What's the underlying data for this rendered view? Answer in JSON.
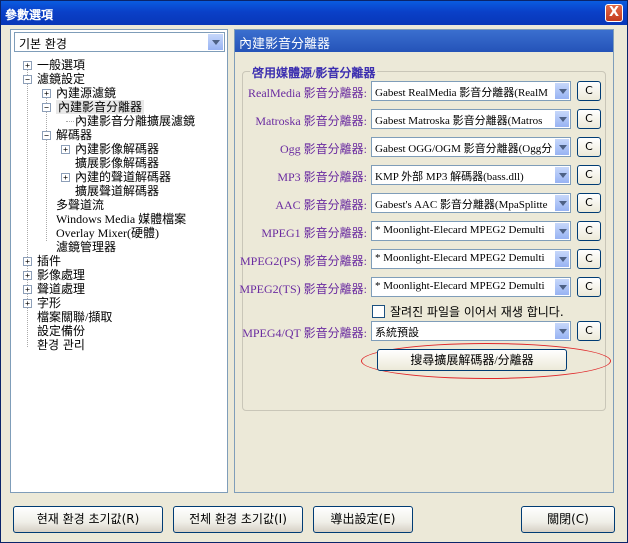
{
  "window": {
    "title": "參數選項",
    "close_glyph": "X"
  },
  "profile_select": {
    "value": "기본 환경"
  },
  "tree": {
    "general": "一般選項",
    "filter_settings": "濾鏡設定",
    "builtin_source_filter": "內建源濾鏡",
    "builtin_splitter": "內建影音分離器",
    "splitter_ext_filter": "內建影音分離擴展濾鏡",
    "decoder": "解碼器",
    "builtin_video_decoder": "內建影像解碼器",
    "ext_video_decoder": "擴展影像解碼器",
    "builtin_audio_decoder": "內建的聲道解碼器",
    "ext_audio_decoder": "擴展聲道解碼器",
    "multi_audio": "多聲道流",
    "wmp_file": "Windows Media 媒體檔案",
    "overlay_mixer": "Overlay Mixer(硬體)",
    "filter_manager": "濾鏡管理器",
    "plugins": "插件",
    "image_processing": "影像處理",
    "audio_processing": "聲道處理",
    "subtitle": "字形",
    "file_assoc": "檔案關聯/擷取",
    "settings_backup": "設定備份",
    "env_manage": "환경 관리"
  },
  "panel": {
    "header": "內建影音分離器",
    "group_title": "啓用媒體源/影音分離器",
    "rows": [
      {
        "label": "RealMedia 影音分離器:",
        "value": "Gabest RealMedia 影音分離器(RealM"
      },
      {
        "label": "Matroska 影音分離器:",
        "value": "Gabest Matroska 影音分離器(Matros"
      },
      {
        "label": "Ogg 影音分離器:",
        "value": "Gabest OGG/OGM 影音分離器(Ogg分"
      },
      {
        "label": "MP3 影音分離器:",
        "value": "KMP 外部 MP3 解碼器(bass.dll)"
      },
      {
        "label": "AAC 影音分離器:",
        "value": "Gabest's AAC 影音分離器(MpaSplitte"
      },
      {
        "label": "MPEG1 影音分離器:",
        "value": "* Moonlight-Elecard MPEG2 Demulti"
      },
      {
        "label": "MPEG2(PS) 影音分離器:",
        "value": "* Moonlight-Elecard MPEG2 Demulti"
      },
      {
        "label": "MPEG2(TS) 影音分離器:",
        "value": "* Moonlight-Elecard MPEG2 Demulti"
      }
    ],
    "resume_checkbox": "잘려진 파일을 이어서 재생 합니다.",
    "mpeg4_label": "MPEG4/QT 影音分離器:",
    "mpeg4_value": "系統預設",
    "c_button": "C",
    "search_button": "搜尋擴展解碼器/分離器"
  },
  "footer": {
    "reset_current": "현재 환경 초기값(R)",
    "reset_all": "전체 환경 초기값(I)",
    "export": "導出設定(E)",
    "close": "關閉(C)"
  }
}
